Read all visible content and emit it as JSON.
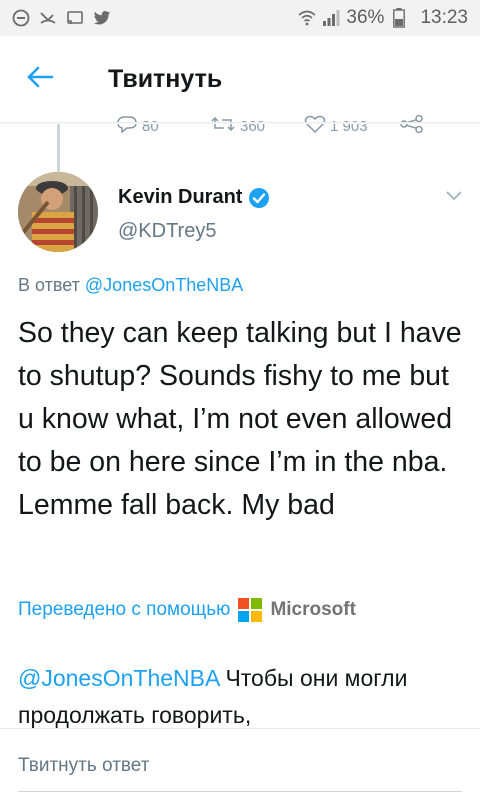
{
  "status_bar": {
    "icons_left": [
      "do-not-disturb-icon",
      "missed-call-icon",
      "cast-icon",
      "twitter-bird-icon"
    ],
    "icons_right": [
      "wifi-icon",
      "signal-icon",
      "battery-icon"
    ],
    "battery": "36%",
    "time": "13:23"
  },
  "header": {
    "title": "Твитнуть"
  },
  "previous_tweet_actions": {
    "replies": "80",
    "retweets": "360",
    "likes": "1 903"
  },
  "tweet": {
    "author_name": "Kevin Durant",
    "author_handle": "@KDTrey5",
    "reply_prefix": "В ответ",
    "reply_mention": "@JonesOnTheNBA",
    "text": "So they can keep talking but I have to shutup? Sounds fishy to me but u know what, I’m not even allowed to be on here since I’m in the nba. Lemme fall back. My bad",
    "translated_by": "Переведено с помощью",
    "translator": "Microsoft",
    "translation_mention": "@JonesOnTheNBA",
    "translation_text": " Чтобы они могли продолжать говорить,"
  },
  "reply_box": {
    "placeholder": "Твитнуть ответ"
  },
  "colors": {
    "accent": "#1da1f2",
    "secondary_text": "#657786",
    "verified": "#1da1f2"
  }
}
